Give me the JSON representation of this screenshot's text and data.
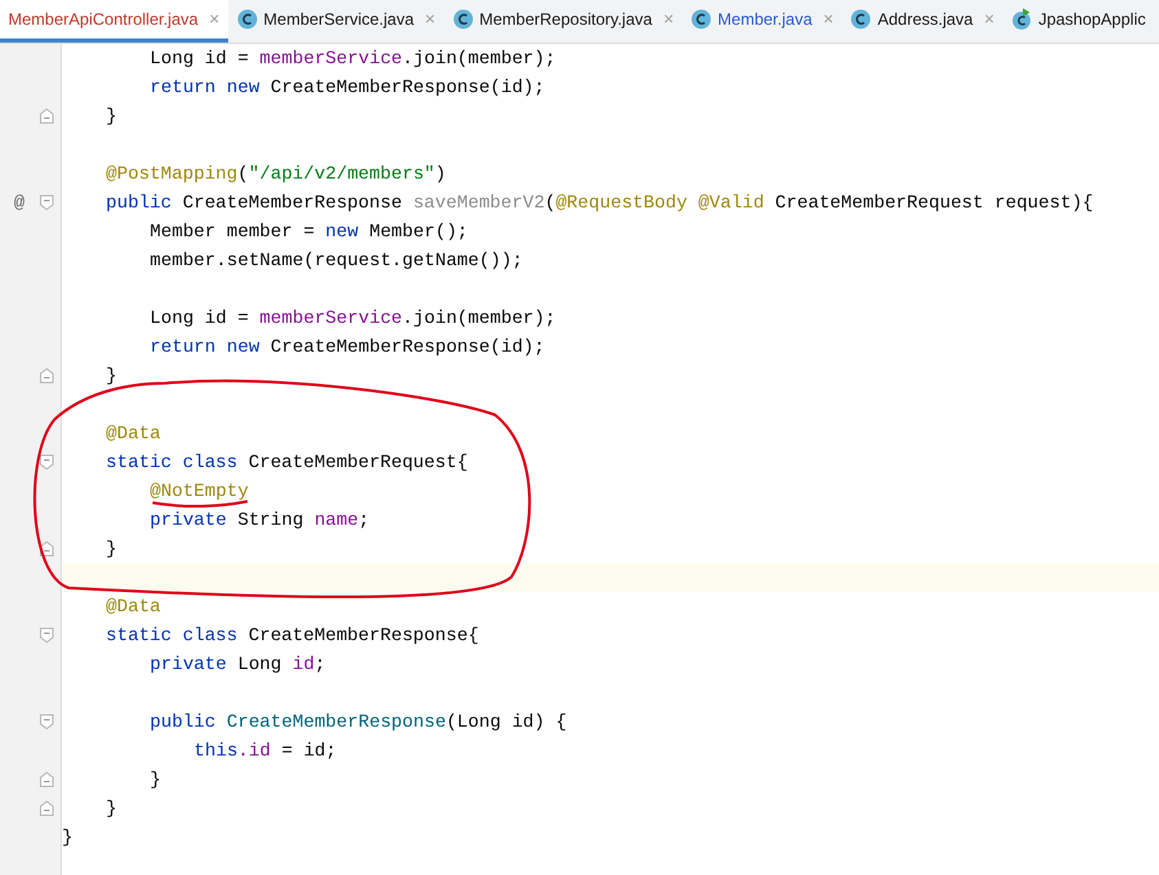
{
  "tabs": [
    {
      "label": "MemberApiController.java",
      "selected": true,
      "kind": "plain",
      "color": "#c0392b",
      "close": "×"
    },
    {
      "label": "MemberService.java",
      "selected": false,
      "kind": "class",
      "color": "#1a1a1a",
      "close": "×"
    },
    {
      "label": "MemberRepository.java",
      "selected": false,
      "kind": "class",
      "color": "#1a1a1a",
      "close": "×"
    },
    {
      "label": "Member.java",
      "selected": false,
      "kind": "class",
      "color": "#2a5ad0",
      "close": "×"
    },
    {
      "label": "Address.java",
      "selected": false,
      "kind": "class",
      "color": "#1a1a1a",
      "close": "×"
    },
    {
      "label": "JpashopApplic",
      "selected": false,
      "kind": "runnable",
      "color": "#1a1a1a"
    }
  ],
  "editor": {
    "class_body": [
      {
        "kind": "code",
        "children": [
          {
            "kind": "code",
            "tokens": [
              {
                "kind": "plain",
                "text": "Long id = "
              },
              {
                "kind": "field",
                "text": "memberService"
              },
              {
                "kind": "plain",
                "text": ".join(member);"
              }
            ]
          },
          {
            "kind": "code",
            "tokens": [
              {
                "kind": "keyword",
                "text": "return new "
              },
              {
                "kind": "plain",
                "text": "CreateMemberResponse(id);"
              }
            ]
          }
        ]
      },
      {
        "kind": "code",
        "fold": {
          "kind": "end"
        },
        "tokens": [
          {
            "kind": "plain",
            "text": "}"
          }
        ]
      },
      {
        "kind": "blank"
      },
      {
        "kind": "code",
        "tokens": [
          {
            "kind": "annotation",
            "text": "@PostMapping"
          },
          {
            "kind": "plain",
            "text": "("
          },
          {
            "kind": "string",
            "text": "\"/api/v2/members\""
          },
          {
            "kind": "plain",
            "text": ")"
          }
        ]
      },
      {
        "kind": "code",
        "fold": {
          "kind": "start"
        },
        "gutter_mark": "@",
        "tokens": [
          {
            "kind": "keyword",
            "text": "public "
          },
          {
            "kind": "plain",
            "text": "CreateMemberResponse "
          },
          {
            "kind": "unused",
            "text": "saveMemberV2"
          },
          {
            "kind": "plain",
            "text": "("
          },
          {
            "kind": "annotation",
            "text": "@RequestBody @Valid "
          },
          {
            "kind": "plain",
            "text": "CreateMemberRequest request){"
          }
        ],
        "children": [
          {
            "kind": "code",
            "tokens": [
              {
                "kind": "plain",
                "text": "Member member = "
              },
              {
                "kind": "keyword",
                "text": "new "
              },
              {
                "kind": "plain",
                "text": "Member();"
              }
            ]
          },
          {
            "kind": "code",
            "tokens": [
              {
                "kind": "plain",
                "text": "member.setName(request.getName());"
              }
            ]
          },
          {
            "kind": "blank"
          },
          {
            "kind": "code",
            "tokens": [
              {
                "kind": "plain",
                "text": "Long id = "
              },
              {
                "kind": "field",
                "text": "memberService"
              },
              {
                "kind": "plain",
                "text": ".join(member);"
              }
            ]
          },
          {
            "kind": "code",
            "tokens": [
              {
                "kind": "keyword",
                "text": "return new "
              },
              {
                "kind": "plain",
                "text": "CreateMemberResponse(id);"
              }
            ]
          }
        ]
      },
      {
        "kind": "code",
        "fold": {
          "kind": "end"
        },
        "tokens": [
          {
            "kind": "plain",
            "text": "}"
          }
        ]
      },
      {
        "kind": "blank"
      },
      {
        "kind": "code",
        "tokens": [
          {
            "kind": "annotation",
            "text": "@Data"
          }
        ]
      },
      {
        "kind": "code",
        "fold": {
          "kind": "start"
        },
        "tokens": [
          {
            "kind": "keyword",
            "text": "static class "
          },
          {
            "kind": "plain",
            "text": "CreateMemberRequest{"
          }
        ],
        "children": [
          {
            "kind": "code",
            "tokens": [
              {
                "kind": "annotation",
                "text": "@NotEmpty"
              }
            ]
          },
          {
            "kind": "code",
            "tokens": [
              {
                "kind": "keyword",
                "text": "private "
              },
              {
                "kind": "plain",
                "text": "String "
              },
              {
                "kind": "field",
                "text": "name"
              },
              {
                "kind": "plain",
                "text": ";"
              }
            ]
          }
        ]
      },
      {
        "kind": "code",
        "fold": {
          "kind": "end"
        },
        "tokens": [
          {
            "kind": "plain",
            "text": "}"
          }
        ]
      },
      {
        "kind": "blank",
        "current": true
      },
      {
        "kind": "code",
        "tokens": [
          {
            "kind": "annotation",
            "text": "@Data"
          }
        ]
      },
      {
        "kind": "code",
        "fold": {
          "kind": "start"
        },
        "tokens": [
          {
            "kind": "keyword",
            "text": "static class "
          },
          {
            "kind": "plain",
            "text": "CreateMemberResponse{"
          }
        ],
        "children": [
          {
            "kind": "code",
            "tokens": [
              {
                "kind": "keyword",
                "text": "private "
              },
              {
                "kind": "plain",
                "text": "Long "
              },
              {
                "kind": "field",
                "text": "id"
              },
              {
                "kind": "plain",
                "text": ";"
              }
            ]
          },
          {
            "kind": "blank"
          },
          {
            "kind": "code",
            "fold": {
              "kind": "start"
            },
            "tokens": [
              {
                "kind": "keyword",
                "text": "public "
              },
              {
                "kind": "declaration",
                "text": "CreateMemberResponse"
              },
              {
                "kind": "plain",
                "text": "(Long id) {"
              }
            ],
            "children": [
              {
                "kind": "code",
                "tokens": [
                  {
                    "kind": "keyword",
                    "text": "this"
                  },
                  {
                    "kind": "field",
                    "text": ".id"
                  },
                  {
                    "kind": "plain",
                    "text": " = id;"
                  }
                ]
              }
            ]
          },
          {
            "kind": "code",
            "fold": {
              "kind": "end"
            },
            "tokens": [
              {
                "kind": "plain",
                "text": "}"
              }
            ]
          }
        ]
      },
      {
        "kind": "code",
        "fold": {
          "kind": "end"
        },
        "tokens": [
          {
            "kind": "plain",
            "text": "}"
          }
        ]
      }
    ],
    "closing": {
      "kind": "code",
      "tokens": [
        {
          "kind": "plain",
          "text": "}"
        }
      ]
    }
  }
}
